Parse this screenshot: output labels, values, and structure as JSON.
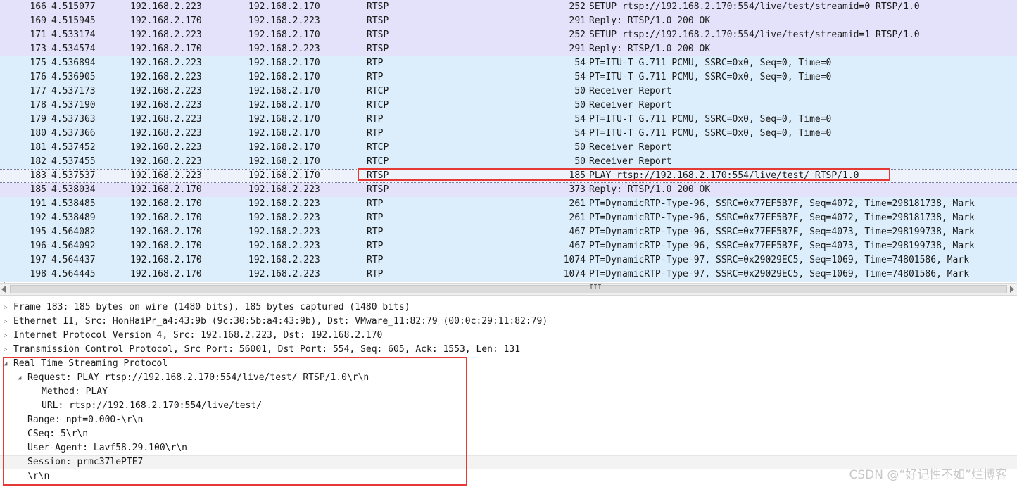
{
  "packets": [
    {
      "no": "166",
      "time": "4.515077",
      "src": "192.168.2.223",
      "dst": "192.168.2.170",
      "proto": "RTSP",
      "len": "252",
      "info": "SETUP rtsp://192.168.2.170:554/live/test/streamid=0 RTSP/1.0"
    },
    {
      "no": "169",
      "time": "4.515945",
      "src": "192.168.2.170",
      "dst": "192.168.2.223",
      "proto": "RTSP",
      "len": "291",
      "info": "Reply: RTSP/1.0 200 OK"
    },
    {
      "no": "171",
      "time": "4.533174",
      "src": "192.168.2.223",
      "dst": "192.168.2.170",
      "proto": "RTSP",
      "len": "252",
      "info": "SETUP rtsp://192.168.2.170:554/live/test/streamid=1 RTSP/1.0"
    },
    {
      "no": "173",
      "time": "4.534574",
      "src": "192.168.2.170",
      "dst": "192.168.2.223",
      "proto": "RTSP",
      "len": "291",
      "info": "Reply: RTSP/1.0 200 OK"
    },
    {
      "no": "175",
      "time": "4.536894",
      "src": "192.168.2.223",
      "dst": "192.168.2.170",
      "proto": "RTP",
      "len": "54",
      "info": "PT=ITU-T G.711 PCMU, SSRC=0x0, Seq=0, Time=0"
    },
    {
      "no": "176",
      "time": "4.536905",
      "src": "192.168.2.223",
      "dst": "192.168.2.170",
      "proto": "RTP",
      "len": "54",
      "info": "PT=ITU-T G.711 PCMU, SSRC=0x0, Seq=0, Time=0"
    },
    {
      "no": "177",
      "time": "4.537173",
      "src": "192.168.2.223",
      "dst": "192.168.2.170",
      "proto": "RTCP",
      "len": "50",
      "info": "Receiver Report"
    },
    {
      "no": "178",
      "time": "4.537190",
      "src": "192.168.2.223",
      "dst": "192.168.2.170",
      "proto": "RTCP",
      "len": "50",
      "info": "Receiver Report"
    },
    {
      "no": "179",
      "time": "4.537363",
      "src": "192.168.2.223",
      "dst": "192.168.2.170",
      "proto": "RTP",
      "len": "54",
      "info": "PT=ITU-T G.711 PCMU, SSRC=0x0, Seq=0, Time=0"
    },
    {
      "no": "180",
      "time": "4.537366",
      "src": "192.168.2.223",
      "dst": "192.168.2.170",
      "proto": "RTP",
      "len": "54",
      "info": "PT=ITU-T G.711 PCMU, SSRC=0x0, Seq=0, Time=0"
    },
    {
      "no": "181",
      "time": "4.537452",
      "src": "192.168.2.223",
      "dst": "192.168.2.170",
      "proto": "RTCP",
      "len": "50",
      "info": "Receiver Report"
    },
    {
      "no": "182",
      "time": "4.537455",
      "src": "192.168.2.223",
      "dst": "192.168.2.170",
      "proto": "RTCP",
      "len": "50",
      "info": "Receiver Report"
    },
    {
      "no": "183",
      "time": "4.537537",
      "src": "192.168.2.223",
      "dst": "192.168.2.170",
      "proto": "RTSP",
      "len": "185",
      "info": "PLAY rtsp://192.168.2.170:554/live/test/ RTSP/1.0"
    },
    {
      "no": "185",
      "time": "4.538034",
      "src": "192.168.2.170",
      "dst": "192.168.2.223",
      "proto": "RTSP",
      "len": "373",
      "info": "Reply: RTSP/1.0 200 OK"
    },
    {
      "no": "191",
      "time": "4.538485",
      "src": "192.168.2.170",
      "dst": "192.168.2.223",
      "proto": "RTP",
      "len": "261",
      "info": "PT=DynamicRTP-Type-96, SSRC=0x77EF5B7F, Seq=4072, Time=298181738, Mark"
    },
    {
      "no": "192",
      "time": "4.538489",
      "src": "192.168.2.170",
      "dst": "192.168.2.223",
      "proto": "RTP",
      "len": "261",
      "info": "PT=DynamicRTP-Type-96, SSRC=0x77EF5B7F, Seq=4072, Time=298181738, Mark"
    },
    {
      "no": "195",
      "time": "4.564082",
      "src": "192.168.2.170",
      "dst": "192.168.2.223",
      "proto": "RTP",
      "len": "467",
      "info": "PT=DynamicRTP-Type-96, SSRC=0x77EF5B7F, Seq=4073, Time=298199738, Mark"
    },
    {
      "no": "196",
      "time": "4.564092",
      "src": "192.168.2.170",
      "dst": "192.168.2.223",
      "proto": "RTP",
      "len": "467",
      "info": "PT=DynamicRTP-Type-96, SSRC=0x77EF5B7F, Seq=4073, Time=298199738, Mark"
    },
    {
      "no": "197",
      "time": "4.564437",
      "src": "192.168.2.170",
      "dst": "192.168.2.223",
      "proto": "RTP",
      "len": "1074",
      "info": "PT=DynamicRTP-Type-97, SSRC=0x29029EC5, Seq=1069, Time=74801586, Mark"
    },
    {
      "no": "198",
      "time": "4.564445",
      "src": "192.168.2.170",
      "dst": "192.168.2.223",
      "proto": "RTP",
      "len": "1074",
      "info": "PT=DynamicRTP-Type-97, SSRC=0x29029EC5, Seq=1069, Time=74801586, Mark"
    }
  ],
  "selected_packet": "183",
  "details": [
    {
      "text": "Frame 183: 185 bytes on wire (1480 bits), 185 bytes captured (1480 bits)",
      "state": "collapsed",
      "level": 0
    },
    {
      "text": "Ethernet II, Src: HonHaiPr_a4:43:9b (9c:30:5b:a4:43:9b), Dst: VMware_11:82:79 (00:0c:29:11:82:79)",
      "state": "collapsed",
      "level": 0
    },
    {
      "text": "Internet Protocol Version 4, Src: 192.168.2.223, Dst: 192.168.2.170",
      "state": "collapsed",
      "level": 0
    },
    {
      "text": "Transmission Control Protocol, Src Port: 56001, Dst Port: 554, Seq: 605, Ack: 1553, Len: 131",
      "state": "collapsed",
      "level": 0
    },
    {
      "text": "Real Time Streaming Protocol",
      "state": "expanded",
      "level": 0
    },
    {
      "text": "Request: PLAY rtsp://192.168.2.170:554/live/test/ RTSP/1.0\\r\\n",
      "state": "expanded",
      "level": 1
    },
    {
      "text": "Method: PLAY",
      "state": "leaf",
      "level": 2
    },
    {
      "text": "URL: rtsp://192.168.2.170:554/live/test/",
      "state": "leaf",
      "level": 2
    },
    {
      "text": "Range: npt=0.000-\\r\\n",
      "state": "leaf",
      "level": 1
    },
    {
      "text": "CSeq: 5\\r\\n",
      "state": "leaf",
      "level": 1
    },
    {
      "text": "User-Agent: Lavf58.29.100\\r\\n",
      "state": "leaf",
      "level": 1
    },
    {
      "text": "Session: prmc37lePTE7",
      "state": "leaf",
      "level": 1,
      "highlight": true
    },
    {
      "text": "\\r\\n",
      "state": "leaf",
      "level": 1
    }
  ],
  "scrollbar_grip": "III",
  "watermark": "CSDN @“好记性不如”烂博客",
  "colors": {
    "rtsp_row": "#e4e2fb",
    "rtp_row": "#dceefb",
    "highlight_box": "#e53935"
  }
}
